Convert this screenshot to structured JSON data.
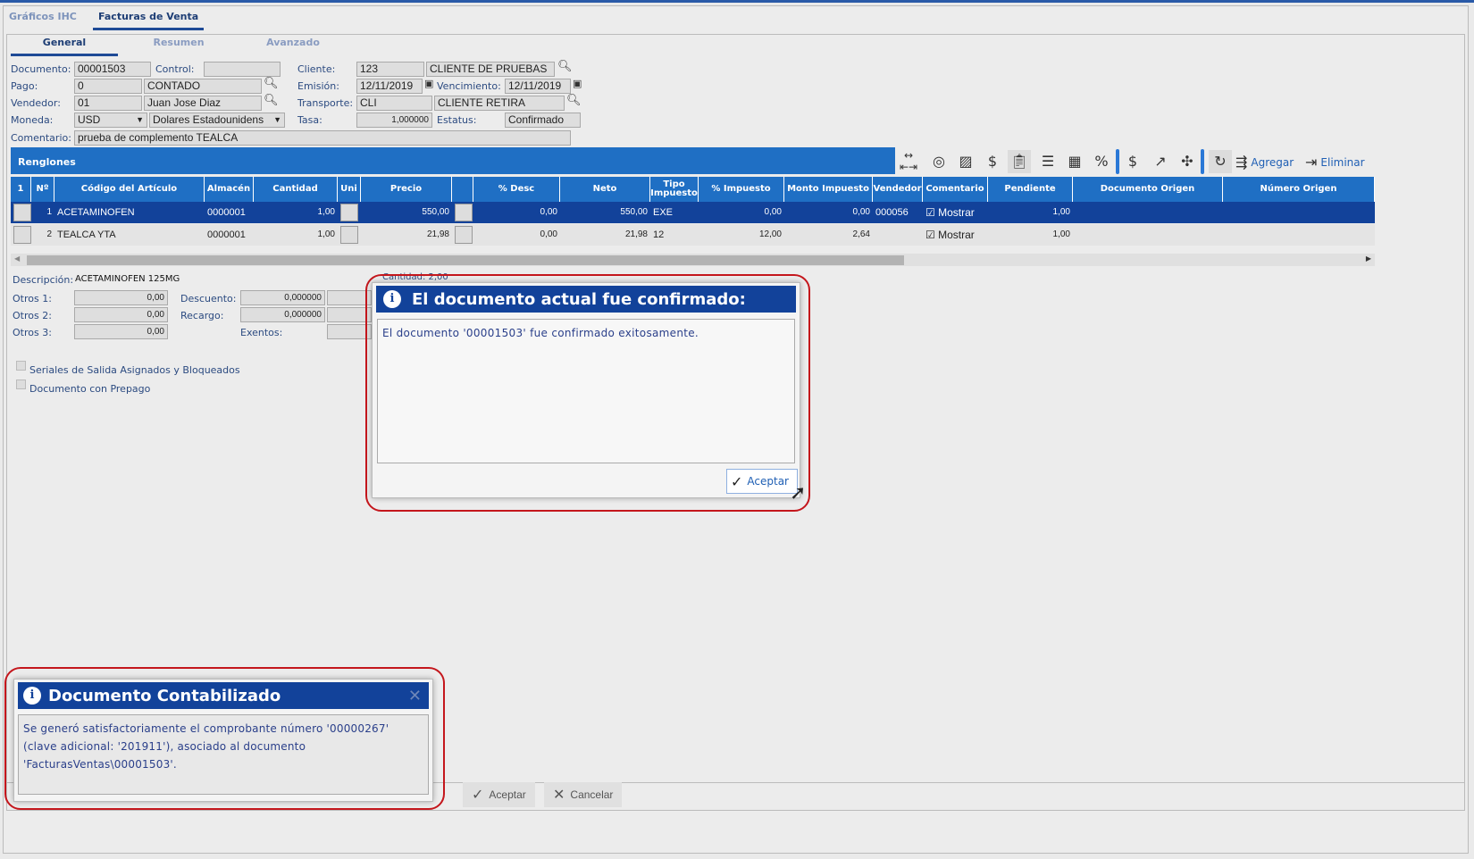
{
  "tabs": [
    "Gráficos IHC",
    "Facturas de Venta"
  ],
  "subtabs": [
    "General",
    "Resumen",
    "Avanzado"
  ],
  "form": {
    "documento_label": "Documento:",
    "documento": "00001503",
    "control_label": "Control:",
    "control": "",
    "pago_label": "Pago:",
    "pago_code": "0",
    "pago_name": "CONTADO",
    "vendedor_label": "Vendedor:",
    "vendedor_code": "01",
    "vendedor_name": "Juan Jose Diaz",
    "moneda_label": "Moneda:",
    "moneda_code": "USD",
    "moneda_name": "Dolares Estadounidens",
    "comentario_label": "Comentario:",
    "comentario": "prueba de complemento TEALCA",
    "cliente_label": "Cliente:",
    "cliente_code": "123",
    "cliente_name": "CLIENTE DE PRUEBAS",
    "emision_label": "Emisión:",
    "emision": "12/11/2019",
    "vencimiento_label": "Vencimiento:",
    "vencimiento": "12/11/2019",
    "transporte_label": "Transporte:",
    "transporte_code": "CLI",
    "transporte_name": "CLIENTE RETIRA",
    "tasa_label": "Tasa:",
    "tasa": "1,000000",
    "estatus_label": "Estatus:",
    "estatus": "Confirmado"
  },
  "renglones": {
    "title": "Renglones",
    "agregar": "Agregar",
    "eliminar": "Eliminar"
  },
  "columns": [
    "1",
    "Nº",
    "Código del Artículo",
    "Almacén",
    "Cantidad",
    "Uni",
    "Precio",
    "",
    "% Desc",
    "Neto",
    "Tipo Impuesto",
    "% Impuesto",
    "Monto Impuesto",
    "Vendedor",
    "Comentario",
    "Pendiente",
    "Documento Origen",
    "Número Origen"
  ],
  "rows": [
    {
      "n": "1",
      "codigo": "ACETAMINOFEN",
      "almacen": "0000001",
      "cantidad": "1,00",
      "precio": "550,00",
      "desc": "0,00",
      "neto": "550,00",
      "tipo": "EXE",
      "pct": "0,00",
      "monto": "0,00",
      "vendedor": "000056",
      "comentario": "Mostrar",
      "pendiente": "1,00"
    },
    {
      "n": "2",
      "codigo": "TEALCA YTA",
      "almacen": "0000001",
      "cantidad": "1,00",
      "precio": "21,98",
      "desc": "0,00",
      "neto": "21,98",
      "tipo": "12",
      "pct": "12,00",
      "monto": "2,64",
      "vendedor": "",
      "comentario": "Mostrar",
      "pendiente": "1,00"
    }
  ],
  "details": {
    "descripcion_label": "Descripción:",
    "descripcion": "ACETAMINOFEN 125MG",
    "cantidad_label": "Cantidad: 2,00",
    "otros1_label": "Otros 1:",
    "otros1": "0,00",
    "otros2_label": "Otros 2:",
    "otros2": "0,00",
    "otros3_label": "Otros 3:",
    "otros3": "0,00",
    "descuento_label": "Descuento:",
    "descuento": "0,000000",
    "recargo_label": "Recargo:",
    "recargo": "0,000000",
    "exentos_label": "Exentos:",
    "seriales": "Seriales de Salida Asignados y Bloqueados",
    "prepago": "Documento con Prepago"
  },
  "dialog": {
    "title": "El documento actual fue confirmado:",
    "message": "El documento '00001503' fue confirmado exitosamente.",
    "ok": "Aceptar"
  },
  "notification": {
    "title": "Documento Contabilizado",
    "message": "Se generó satisfactoriamente el comprobante número '00000267' (clave adicional: '201911'), asociado al documento 'FacturasVentas\\00001503'."
  },
  "footer": {
    "aceptar": "Aceptar",
    "cancelar": "Cancelar"
  }
}
